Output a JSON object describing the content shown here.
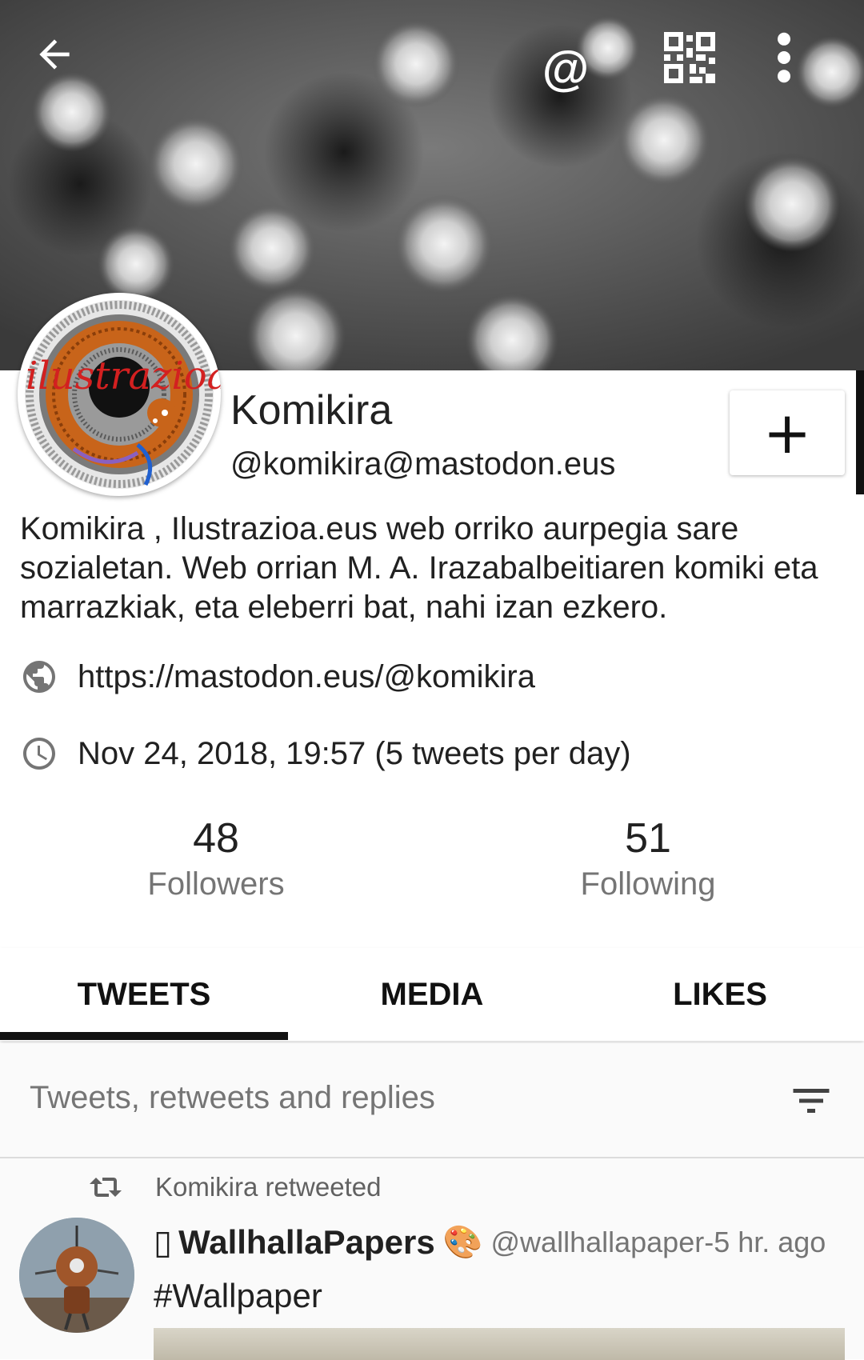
{
  "toolbar": {
    "back_icon": "arrow-left-icon",
    "mention_icon": "at-sign-icon",
    "qr_icon": "qr-code-icon",
    "more_icon": "more-vert-icon",
    "mention_label": "@"
  },
  "profile": {
    "display_name": "Komikira",
    "handle": "@komikira@mastodon.eus",
    "follow_label": "+",
    "bio": "Komikira , Ilustrazioa.eus web orriko aurpegia sare sozialetan. Web orrian M. A. Irazabalbeitiaren komiki eta marrazkiak, eta eleberri bat, nahi izan ezkero.",
    "url": "https://mastodon.eus/@komikira",
    "joined": "Nov 24, 2018, 19:57 (5 tweets per day)",
    "avatar_logo_text": "ilustrazioa"
  },
  "stats": {
    "followers_count": "48",
    "followers_label": "Followers",
    "following_count": "51",
    "following_label": "Following"
  },
  "tabs": [
    {
      "label": "TWEETS",
      "active": true
    },
    {
      "label": "MEDIA",
      "active": false
    },
    {
      "label": "LIKES",
      "active": false
    }
  ],
  "filter": {
    "label": "Tweets, retweets and replies",
    "icon": "filter-list-icon"
  },
  "feed": {
    "retweet_text": "Komikira retweeted",
    "tweet": {
      "name_prefix": "▯",
      "name": "WallhallaPapers",
      "name_emoji": "🎨",
      "handle": "@wallhallapaper-5 hr. ago",
      "text": "#Wallpaper"
    }
  },
  "colors": {
    "accent": "#111111",
    "secondary_text": "#757575",
    "avatar_orange": "#c8641a",
    "avatar_red": "#d32020"
  }
}
